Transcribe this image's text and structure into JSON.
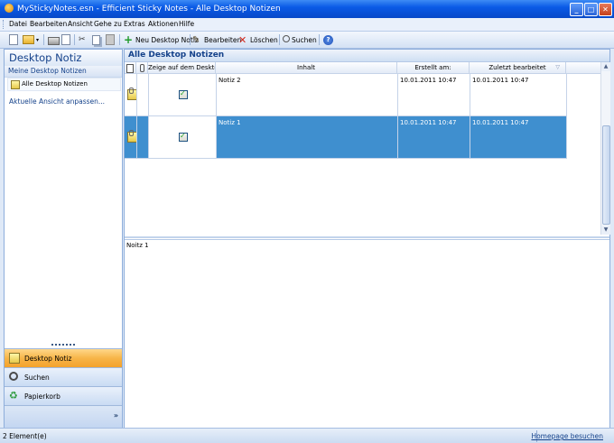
{
  "window": {
    "title": "MyStickyNotes.esn - Efficient Sticky Notes - Alle Desktop Notizen"
  },
  "menu": [
    "Datei",
    "Bearbeiten",
    "Ansicht",
    "Gehe zu",
    "Extras",
    "Aktionen",
    "Hilfe"
  ],
  "toolbar": {
    "new_note": "Neu Desktop Notiz",
    "edit": "Bearbeiten",
    "delete": "Löschen",
    "search": "Suchen"
  },
  "sidebar": {
    "title": "Desktop Notiz",
    "group_label": "Meine Desktop Notizen",
    "selected_item": "Alle Desktop Notizen",
    "customize_link": "Aktuelle Ansicht anpassen...",
    "nav": [
      {
        "label": "Desktop Notiz",
        "active": true
      },
      {
        "label": "Suchen",
        "active": false
      },
      {
        "label": "Papierkorb",
        "active": false
      }
    ]
  },
  "main": {
    "title": "Alle Desktop Notizen",
    "columns": {
      "show_on_desktop": "Zeige auf dem Desktop",
      "content": "Inhalt",
      "created": "Erstellt am:",
      "modified": "Zuletzt bearbeitet"
    },
    "rows": [
      {
        "content": "Notiz 2",
        "show_on_desktop": true,
        "created": "10.01.2011 10:47",
        "modified": "10.01.2011 10:47",
        "selected": false
      },
      {
        "content": "Notiz 1",
        "show_on_desktop": true,
        "created": "10.01.2011 10:47",
        "modified": "10.01.2011 10:47",
        "selected": true
      }
    ],
    "preview_text": "Noitz 1"
  },
  "statusbar": {
    "count": "2 Element(e)",
    "homepage_link": "Homepage besuchen"
  },
  "colors": {
    "selection": "#3f8fcf",
    "active_nav": "#f7b548",
    "header_text": "#15428b",
    "titlebar": "#0a5ae6"
  }
}
